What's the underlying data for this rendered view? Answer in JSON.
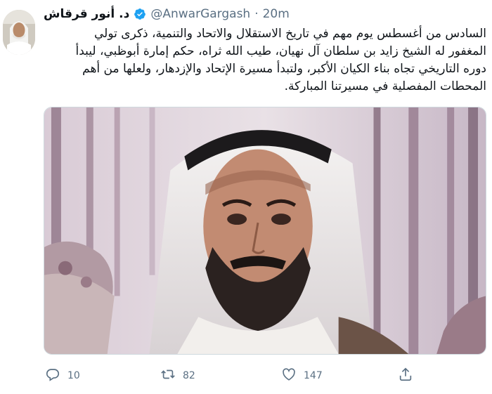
{
  "tweet": {
    "author": {
      "display_name": "د. أنور قرقاش",
      "handle": "@AnwarGargash",
      "verified": true
    },
    "separator": "·",
    "timestamp": "20m",
    "text_lines": [
      "السادس من أغسطس يوم مهم في تاريخ الاستقلال والاتحاد والتنمية، ذكرى تولي",
      "المغفور له الشيخ زايد بن سلطان آل نهيان، طيب الله ثراه، حكم إمارة أبوظبي، ليبدأ",
      "دوره التاريخي تجاه بناء الكيان الأكبر، ولتبدأ مسيرة الإتحاد والإزدهار، ولعلها من أهم",
      "المحطات المفصلية في مسيرتنا المباركة."
    ],
    "stats": {
      "replies": "10",
      "retweets": "82",
      "likes": "147"
    }
  },
  "icons": {
    "verified": "verified-badge-icon",
    "reply": "reply-icon",
    "retweet": "retweet-icon",
    "like": "heart-icon",
    "share": "share-icon"
  },
  "colors": {
    "verified": "#1da1f2",
    "secondary_text": "#5b7083",
    "primary_text": "#0f1419"
  }
}
